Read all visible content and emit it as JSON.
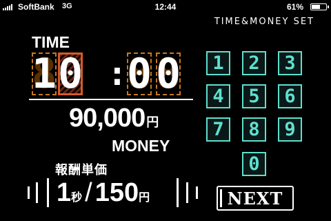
{
  "status_bar": {
    "carrier": "SoftBank",
    "network": "3G",
    "time": "12:44",
    "battery_percent": "61%",
    "battery_level": 0.61
  },
  "header": {
    "title": "TIME&MONEY SET"
  },
  "time_section": {
    "label": "TIME",
    "digits": [
      "1",
      "0",
      "0",
      "0"
    ],
    "separator": ":",
    "selected_digit_index": 1
  },
  "money_section": {
    "amount": "90,000",
    "unit": "円",
    "label": "MONEY"
  },
  "rate_section": {
    "label": "報酬単価",
    "per_value": "1",
    "per_unit": "秒",
    "slash": "/",
    "amount": "150",
    "amount_unit": "円"
  },
  "keypad": {
    "keys": [
      "1",
      "2",
      "3",
      "4",
      "5",
      "6",
      "7",
      "8",
      "9",
      "0"
    ]
  },
  "next_button": {
    "label": "NEXT"
  },
  "colors": {
    "accent_keypad": "#5ee0d0",
    "digit_frame": "#c8781e",
    "digit_selected": "#d55a2a",
    "background": "#000000",
    "text": "#ffffff"
  }
}
